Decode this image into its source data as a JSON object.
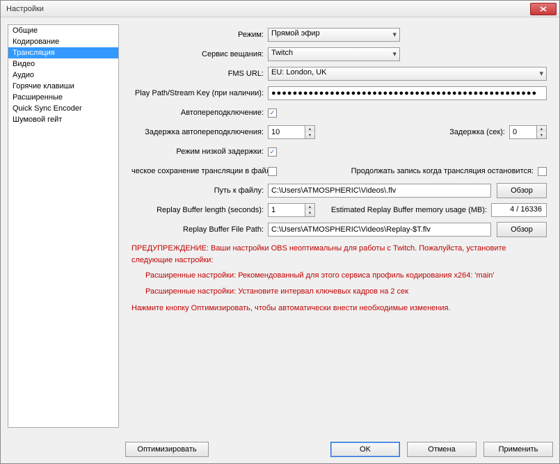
{
  "window": {
    "title": "Настройки"
  },
  "sidebar": {
    "items": [
      {
        "label": "Общие"
      },
      {
        "label": "Кодирование"
      },
      {
        "label": "Трансляция"
      },
      {
        "label": "Видео"
      },
      {
        "label": "Аудио"
      },
      {
        "label": "Горячие клавиши"
      },
      {
        "label": "Расширенные"
      },
      {
        "label": "Quick Sync Encoder"
      },
      {
        "label": "Шумовой гейт"
      }
    ],
    "selectedIndex": 2
  },
  "form": {
    "mode_label": "Режим:",
    "mode_value": "Прямой эфир",
    "service_label": "Сервис вещания:",
    "service_value": "Twitch",
    "fms_label": "FMS URL:",
    "fms_value": "EU: London, UK",
    "playpath_label": "Play Path/Stream Key (при наличии):",
    "playpath_value": "●●●●●●●●●●●●●●●●●●●●●●●●●●●●●●●●●●●●●●●●●●●●●●●●●●",
    "autoreconnect_label": "Автопереподключение:",
    "autoreconnect_checked": true,
    "autoreconnect_delay_label": "Задержка автопереподключения:",
    "autoreconnect_delay_value": "10",
    "delay_label": "Задержка (сек):",
    "delay_value": "0",
    "lowlatency_label": "Режим низкой задержки:",
    "lowlatency_checked": true,
    "savefile_label": "ческое сохранение трансляции в файл:",
    "savefile_checked": false,
    "keeprecord_label": "Продолжать запись когда трансляция остановится:",
    "keeprecord_checked": false,
    "filepath_label": "Путь к файлу:",
    "filepath_value": "C:\\Users\\ATMOSPHERIC\\Videos\\.flv",
    "browse_label": "Обзор",
    "replay_len_label": "Replay Buffer length (seconds):",
    "replay_len_value": "1",
    "replay_mem_label": "Estimated Replay Buffer memory usage (MB):",
    "replay_mem_value": "4 / 16336",
    "replay_path_label": "Replay Buffer File Path:",
    "replay_path_value": "C:\\Users\\ATMOSPHERIC\\Videos\\Replay-$T.flv"
  },
  "warning": {
    "line1": "ПРЕДУПРЕЖДЕНИЕ: Ваши настройки OBS неоптимальны для работы с Twitch. Пожалуйста, установите следующие настройки:",
    "line2": "Расширенные настройки: Рекомендованный для этого сервиса профиль кодирования x264: 'main'",
    "line3": "Расширенные настройки: Установите интервал ключевых кадров на 2 сек",
    "action": "Нажмите кнопку Оптимизировать, чтобы автоматически внести необходимые изменения."
  },
  "footer": {
    "optimize": "Оптимизировать",
    "ok": "OK",
    "cancel": "Отмена",
    "apply": "Применить"
  }
}
